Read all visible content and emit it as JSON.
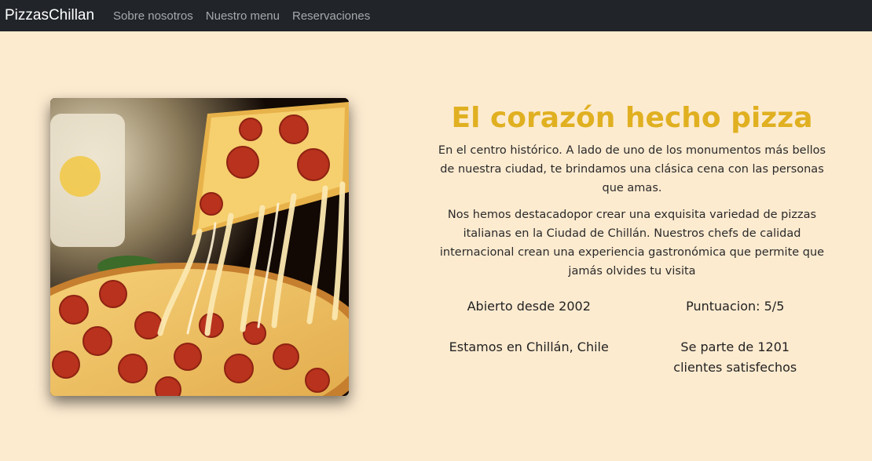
{
  "nav": {
    "brand": "PizzasChillan",
    "links": [
      "Sobre nosotros",
      "Nuestro menu",
      "Reservaciones"
    ]
  },
  "hero": {
    "image_icon": "pizza-slice-image",
    "title": "El corazón hecho pizza",
    "paragraphs": [
      "En el centro histórico. A lado de uno de los monumentos más bellos de nuestra ciudad, te brindamos una clásica cena con las personas que amas.",
      "Nos hemos destacadopor crear una exquisita variedad de pizzas italianas en la Ciudad de Chillán. Nuestros chefs de calidad internacional crean una experiencia gastronómica que permite que jamás olvides tu visita"
    ]
  },
  "facts": [
    "Abierto desde 2002",
    "Puntuacion: 5/5",
    "Estamos en Chillán, Chile",
    "Se parte de 1201 clientes satisfechos"
  ],
  "colors": {
    "background": "#fdebd0",
    "navbar": "#212529",
    "accent": "#e0b021"
  }
}
